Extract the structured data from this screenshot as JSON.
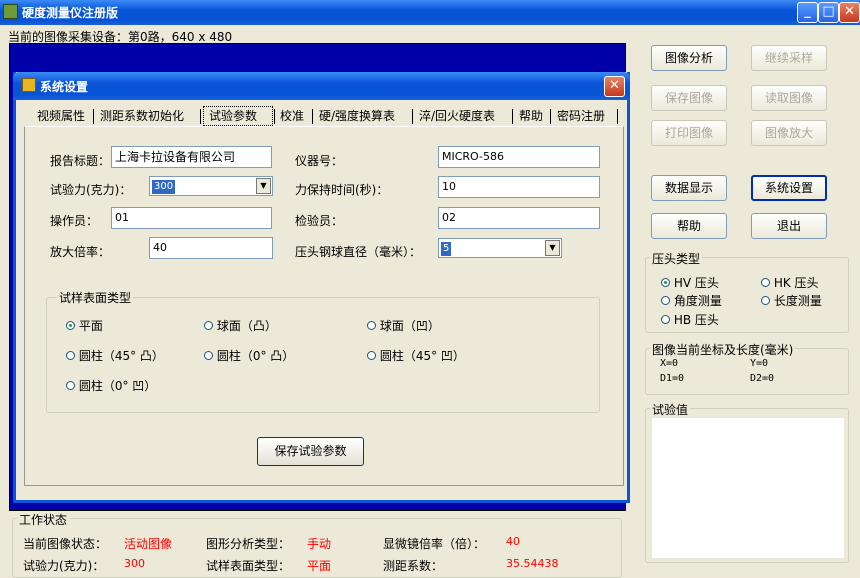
{
  "window": {
    "title": "硬度测量仪注册版"
  },
  "device_line": "当前的图像采集设备：第0路，640 x 480",
  "right_buttons": {
    "image_analysis": "图像分析",
    "continue_sampling": "继续采样",
    "save_image": "保存图像",
    "read_image": "读取图像",
    "print_image": "打印图像",
    "zoom_image": "图像放大",
    "data_display": "数据显示",
    "system_settings": "系统设置",
    "help": "帮助",
    "exit": "退出"
  },
  "indenter_type": {
    "legend": "压头类型",
    "options": [
      "HV 压头",
      "HK 压头",
      "角度测量",
      "长度测量",
      "HB 压头"
    ],
    "selected": "HV 压头"
  },
  "coords": {
    "legend": "图像当前坐标及长度(毫米)",
    "x": "X=0",
    "y": "Y=0",
    "d1": "D1=0",
    "d2": "D2=0"
  },
  "test_value": {
    "legend": "试验值"
  },
  "work_status": {
    "legend": "工作状态",
    "image_state_label": "当前图像状态：",
    "image_state_value": "活动图像",
    "analysis_type_label": "图形分析类型：",
    "analysis_type_value": "手动",
    "magnification_label": "显微镜倍率（倍）：",
    "magnification_value": "40",
    "force_label": "试验力(克力)：",
    "force_value": "300",
    "surface_label": "试样表面类型：",
    "surface_value": "平面",
    "ranging_label": "测距系数：",
    "ranging_value": "35.54438"
  },
  "dialog": {
    "title": "系统设置",
    "tabs": [
      "视频属性",
      "测距系数初始化",
      "试验参数",
      "校准",
      "硬/强度换算表",
      "淬/回火硬度表",
      "帮助",
      "密码注册"
    ],
    "active_tab": "试验参数",
    "fields": {
      "report_title_label": "报告标题：",
      "report_title_value": "上海卡拉设备有限公司",
      "instrument_label": "仪器号：",
      "instrument_value": "MICRO-586",
      "force_label": "试验力(克力)：",
      "force_value": "300",
      "hold_time_label": "力保持时间(秒)：",
      "hold_time_value": "10",
      "operator_label": "操作员：",
      "operator_value": "01",
      "inspector_label": "检验员：",
      "inspector_value": "02",
      "magnification_label": "放大倍率：",
      "magnification_value": "40",
      "ball_diameter_label": "压头钢球直径（毫米）：",
      "ball_diameter_value": "5"
    },
    "surface_group": {
      "legend": "试样表面类型",
      "options": [
        "平面",
        "球面（凸）",
        "球面（凹）",
        "圆柱（45° 凸）",
        "圆柱（0° 凸）",
        "圆柱（45° 凹）",
        "圆柱（0° 凹）"
      ],
      "selected": "平面"
    },
    "save_button": "保存试验参数"
  },
  "colors": {
    "titlebar": "#0a55d8",
    "image_area": "#0000a8",
    "status_value": "#ff0000"
  }
}
